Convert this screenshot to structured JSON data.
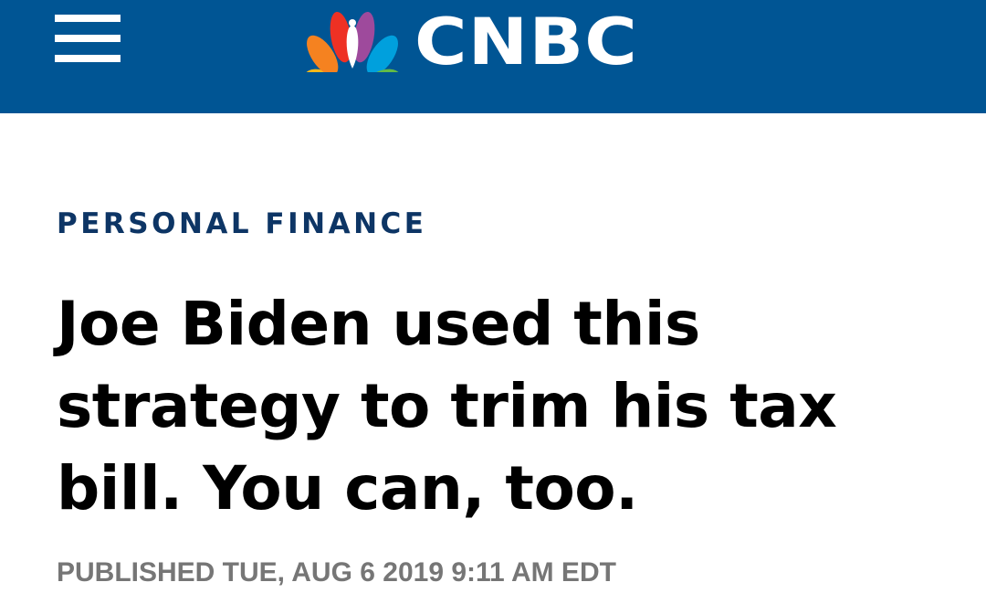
{
  "header": {
    "brand": "CNBC",
    "menu_icon": "hamburger-menu-icon",
    "logo_icon": "nbc-peacock-icon",
    "background_color": "#005594",
    "peacock_colors": [
      "#f5b81a",
      "#ee3124",
      "#9e4a9c",
      "#00a0dd",
      "#62bb46",
      "#f58220"
    ]
  },
  "article": {
    "section": "PERSONAL FINANCE",
    "headline": "Joe Biden used this strategy to trim his tax bill. You can, too.",
    "published": "PUBLISHED TUE, AUG 6 2019 9:11 AM EDT"
  },
  "colors": {
    "section_label": "#0d3565",
    "headline": "#000000",
    "published": "#767676"
  }
}
